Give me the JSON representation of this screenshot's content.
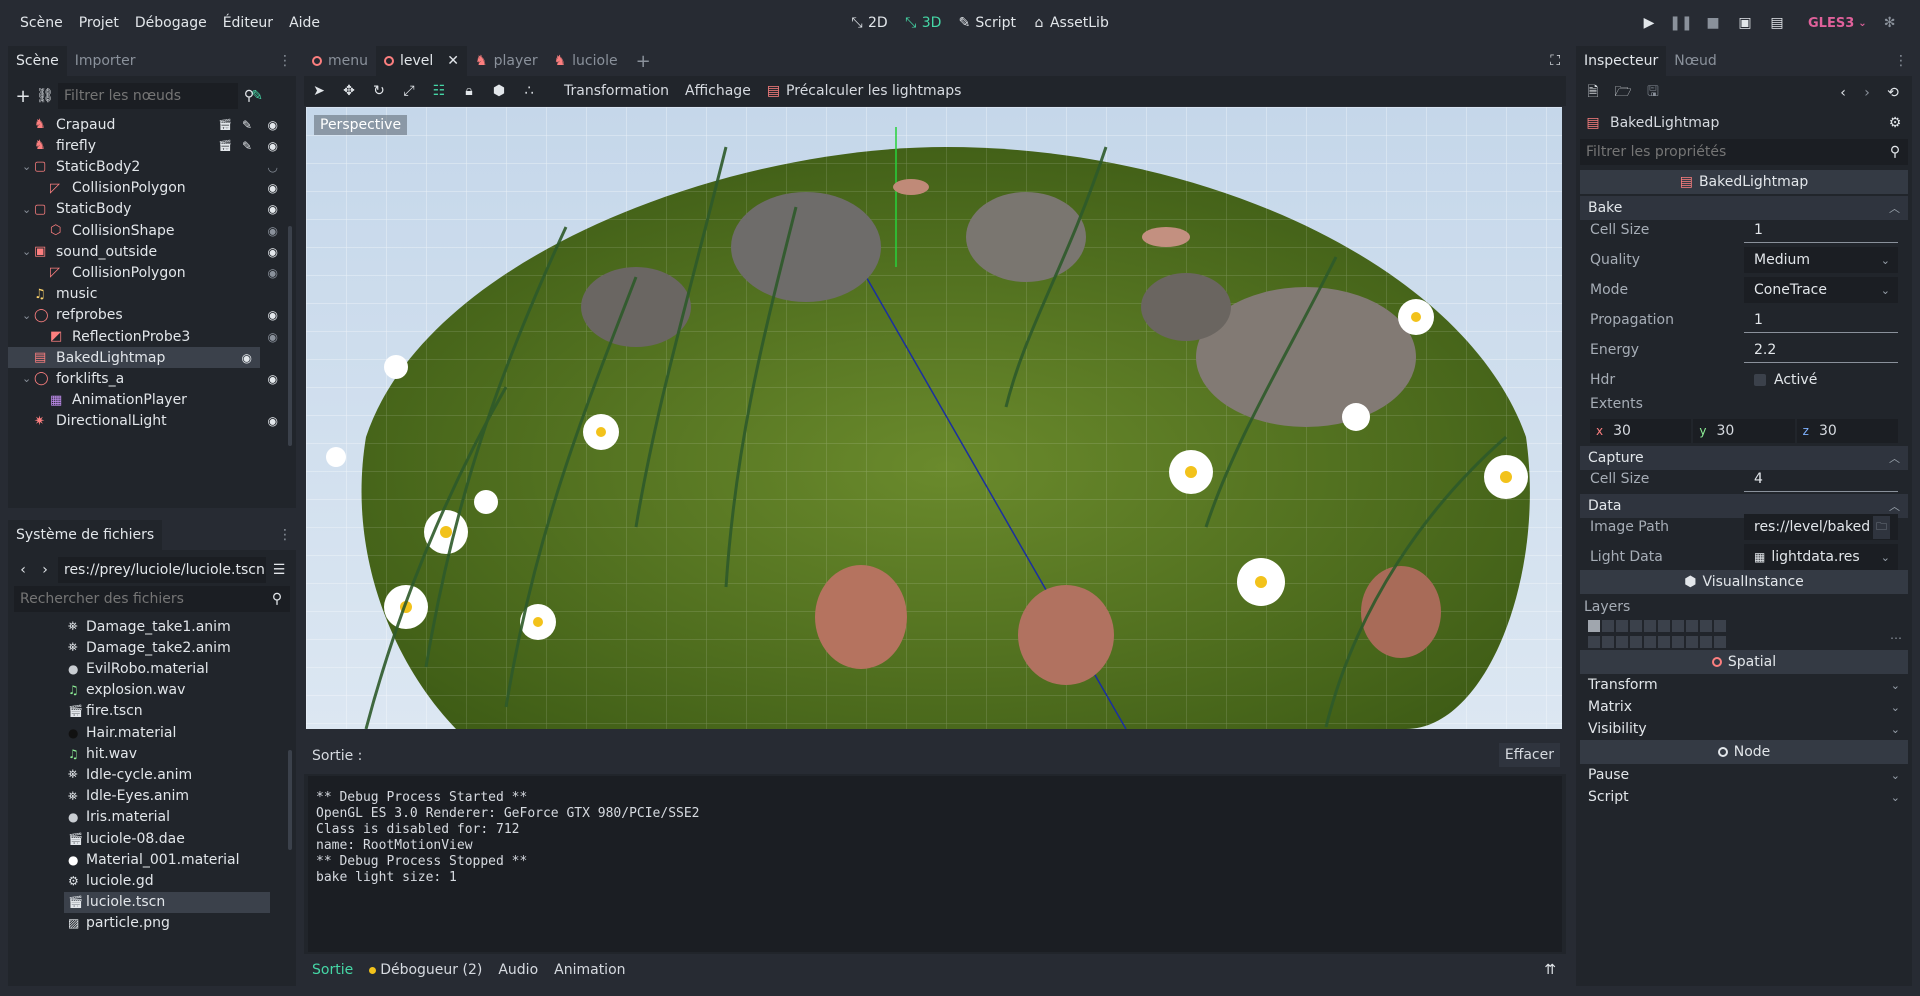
{
  "menubar": {
    "menus": [
      "Scène",
      "Projet",
      "Débogage",
      "Éditeur",
      "Aide"
    ],
    "modes": [
      {
        "label": "2D",
        "active": false
      },
      {
        "label": "3D",
        "active": true
      },
      {
        "label": "Script",
        "active": false
      },
      {
        "label": "AssetLib",
        "active": false
      }
    ],
    "renderer": "GLES3"
  },
  "scene_dock": {
    "tabs": [
      "Scène",
      "Importer"
    ],
    "filter_placeholder": "Filtrer les nœuds",
    "nodes": [
      {
        "label": "Crapaud",
        "icon": "character-icon",
        "indent": 1
      },
      {
        "label": "firefly",
        "icon": "character-icon",
        "indent": 1
      },
      {
        "label": "StaticBody2",
        "icon": "static-body-icon",
        "indent": 1
      },
      {
        "label": "CollisionPolygon",
        "icon": "collision-polygon-icon",
        "indent": 2
      },
      {
        "label": "StaticBody",
        "icon": "static-body-icon",
        "indent": 1
      },
      {
        "label": "CollisionShape",
        "icon": "collision-shape-icon",
        "indent": 2
      },
      {
        "label": "sound_outside",
        "icon": "audio-area-icon",
        "indent": 1
      },
      {
        "label": "CollisionPolygon",
        "icon": "collision-polygon-icon",
        "indent": 2
      },
      {
        "label": "music",
        "icon": "music-icon",
        "indent": 1
      },
      {
        "label": "refprobes",
        "icon": "spatial-icon",
        "indent": 1
      },
      {
        "label": "ReflectionProbe3",
        "icon": "reflection-probe-icon",
        "indent": 2
      },
      {
        "label": "BakedLightmap",
        "icon": "baked-lightmap-icon",
        "indent": 1
      },
      {
        "label": "forklifts_a",
        "icon": "spatial-icon",
        "indent": 1
      },
      {
        "label": "AnimationPlayer",
        "icon": "animation-player-icon",
        "indent": 2
      },
      {
        "label": "DirectionalLight",
        "icon": "light-icon",
        "indent": 1
      }
    ]
  },
  "filesystem": {
    "title": "Système de fichiers",
    "path": "res://prey/luciole/luciole.tscn",
    "search_placeholder": "Rechercher des fichiers",
    "files": [
      {
        "name": "Damage_take1.anim",
        "icon": "animation-icon"
      },
      {
        "name": "Damage_take2.anim",
        "icon": "animation-icon"
      },
      {
        "name": "EvilRobo.material",
        "icon": "material-icon"
      },
      {
        "name": "explosion.wav",
        "icon": "audio-icon"
      },
      {
        "name": "fire.tscn",
        "icon": "scene-icon"
      },
      {
        "name": "Hair.material",
        "icon": "material-icon"
      },
      {
        "name": "hit.wav",
        "icon": "audio-icon"
      },
      {
        "name": "Idle-cycle.anim",
        "icon": "animation-icon"
      },
      {
        "name": "Idle-Eyes.anim",
        "icon": "animation-icon"
      },
      {
        "name": "Iris.material",
        "icon": "material-icon"
      },
      {
        "name": "luciole-08.dae",
        "icon": "scene-icon"
      },
      {
        "name": "Material_001.material",
        "icon": "material-icon"
      },
      {
        "name": "luciole.gd",
        "icon": "script-icon"
      },
      {
        "name": "luciole.tscn",
        "icon": "scene-icon"
      },
      {
        "name": "particle.png",
        "icon": "image-icon"
      }
    ]
  },
  "editor_tabs": [
    "menu",
    "level",
    "player",
    "luciole"
  ],
  "viewport_toolbar": {
    "menus": [
      "Transformation",
      "Affichage"
    ],
    "bake_button": "Précalculer les lightmaps",
    "perspective_label": "Perspective"
  },
  "output": {
    "title": "Sortie :",
    "clear_button": "Effacer",
    "lines": [
      "** Debug Process Started **",
      "OpenGL ES 3.0 Renderer: GeForce GTX 980/PCIe/SSE2",
      "Class is disabled for: 712",
      "name: RootMotionView",
      "** Debug Process Stopped **",
      "bake light size: 1"
    ],
    "bottom_tabs": [
      "Sortie",
      "Débogueur (2)",
      "Audio",
      "Animation"
    ]
  },
  "inspector": {
    "tabs": [
      "Inspecteur",
      "Nœud"
    ],
    "node_name": "BakedLightmap",
    "filter_placeholder": "Filtrer les propriétés",
    "class_header": "BakedLightmap",
    "sections": {
      "bake": "Bake",
      "capture": "Capture",
      "data": "Data"
    },
    "bake": {
      "cell_size_label": "Cell Size",
      "cell_size": "1",
      "quality_label": "Quality",
      "quality": "Medium",
      "mode_label": "Mode",
      "mode": "ConeTrace",
      "propagation_label": "Propagation",
      "propagation": "1",
      "energy_label": "Energy",
      "energy": "2.2",
      "hdr_label": "Hdr",
      "hdr": "Activé",
      "extents_label": "Extents",
      "extents": {
        "x_label": "x",
        "x": "30",
        "y_label": "y",
        "y": "30",
        "z_label": "z",
        "z": "30"
      }
    },
    "capture": {
      "cell_size_label": "Cell Size",
      "cell_size": "4"
    },
    "data": {
      "image_path_label": "Image Path",
      "image_path": "res://level/baked",
      "light_data_label": "Light Data",
      "light_data": "lightdata.res"
    },
    "visual_instance": "VisualInstance",
    "layers_label": "Layers",
    "spatial": "Spatial",
    "spatial_props": [
      "Transform",
      "Matrix",
      "Visibility"
    ],
    "node": "Node",
    "node_props": [
      "Pause",
      "Script"
    ]
  }
}
